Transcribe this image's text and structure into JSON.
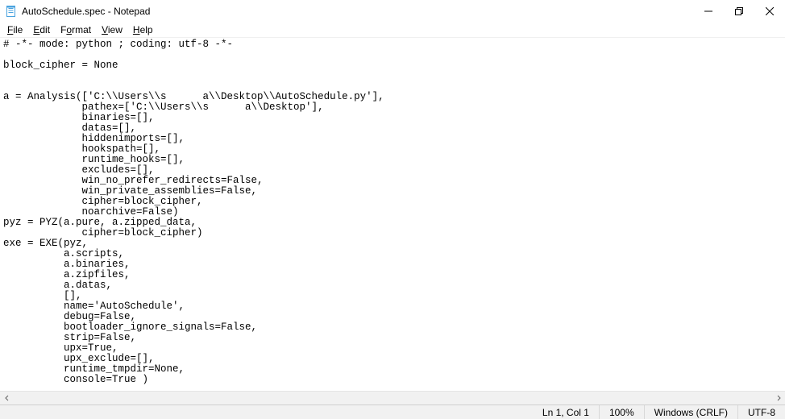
{
  "window": {
    "title": "AutoSchedule.spec - Notepad",
    "icon_name": "notepad-icon"
  },
  "menus": {
    "file": "File",
    "edit": "Edit",
    "format": "Format",
    "view": "View",
    "help": "Help"
  },
  "editor": {
    "content": "# -*- mode: python ; coding: utf-8 -*-\n\nblock_cipher = None\n\n\na = Analysis(['C:\\\\Users\\\\s      a\\\\Desktop\\\\AutoSchedule.py'],\n             pathex=['C:\\\\Users\\\\s      a\\\\Desktop'],\n             binaries=[],\n             datas=[],\n             hiddenimports=[],\n             hookspath=[],\n             runtime_hooks=[],\n             excludes=[],\n             win_no_prefer_redirects=False,\n             win_private_assemblies=False,\n             cipher=block_cipher,\n             noarchive=False)\npyz = PYZ(a.pure, a.zipped_data,\n             cipher=block_cipher)\nexe = EXE(pyz,\n          a.scripts,\n          a.binaries,\n          a.zipfiles,\n          a.datas,\n          [],\n          name='AutoSchedule',\n          debug=False,\n          bootloader_ignore_signals=False,\n          strip=False,\n          upx=True,\n          upx_exclude=[],\n          runtime_tmpdir=None,\n          console=True )"
  },
  "status": {
    "position": "Ln 1, Col 1",
    "zoom": "100%",
    "line_ending": "Windows (CRLF)",
    "encoding": "UTF-8"
  }
}
